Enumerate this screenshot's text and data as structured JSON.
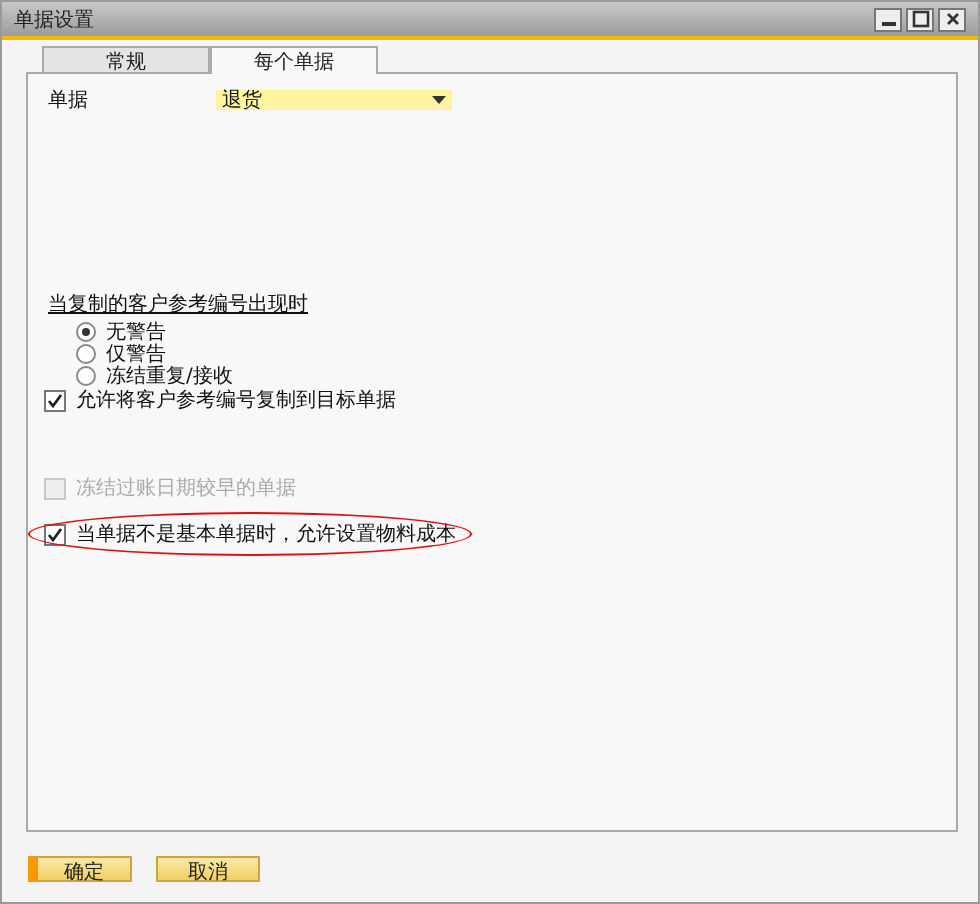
{
  "window": {
    "title": "单据设置"
  },
  "tabs": [
    {
      "label": "常规",
      "selected": false
    },
    {
      "label": "每个单据",
      "selected": true
    }
  ],
  "document_field": {
    "label": "单据",
    "value": "退货"
  },
  "duplicate_section": {
    "heading": "当复制的客户参考编号出现时",
    "options": [
      {
        "label": "无警告",
        "selected": true
      },
      {
        "label": "仅警告",
        "selected": false
      },
      {
        "label": "冻结重复/接收",
        "selected": false
      }
    ]
  },
  "checkboxes": [
    {
      "label": "允许将客户参考编号复制到目标单据",
      "checked": true,
      "disabled": false,
      "highlighted": false,
      "gap_before": false
    },
    {
      "label": "冻结过账日期较早的单据",
      "checked": false,
      "disabled": true,
      "highlighted": false,
      "gap_before": true
    },
    {
      "label": "当单据不是基本单据时，允许设置物料成本",
      "checked": true,
      "disabled": false,
      "highlighted": true,
      "gap_before": false
    }
  ],
  "buttons": [
    {
      "label": "确定",
      "kind": "primary"
    },
    {
      "label": "取消",
      "kind": "secondary"
    }
  ]
}
